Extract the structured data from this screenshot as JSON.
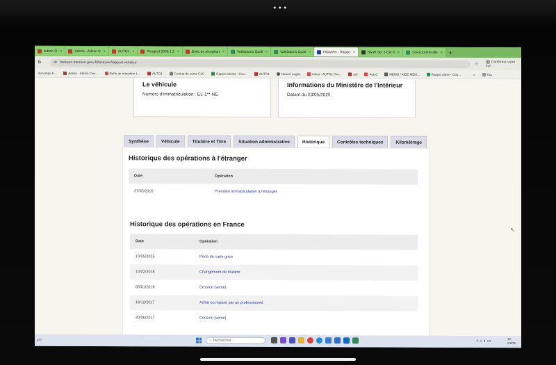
{
  "browser": {
    "tabs": [
      {
        "label": "Admin O"
      },
      {
        "label": "Admin - Admin C"
      },
      {
        "label": "AUTO1"
      },
      {
        "label": "Peugeot 2008 1.2"
      },
      {
        "label": "Boite de réception"
      },
      {
        "label": "Validations Quali"
      },
      {
        "label": "Validations Quali"
      },
      {
        "label": "HistoVec - Rappo"
      },
      {
        "label": "BMW Ser 3 Gie fr"
      },
      {
        "label": "Suivi portefeuille"
      }
    ],
    "active_tab_index": 7,
    "url": "histovec.interieur.gouv.fr/histovec/rapport-vendeur",
    "confirm_label": "Confirmer votre syn",
    "bookmarks": [
      {
        "label": "du temps A..."
      },
      {
        "label": "Admin - Admin Cen..."
      },
      {
        "label": "Boîte de réception L..."
      },
      {
        "label": "AUTO1"
      },
      {
        "label": "Contrat de vente C2C"
      },
      {
        "label": "Rappel clients - Gou..."
      },
      {
        "label": "AUTO1"
      },
      {
        "label": "Nouvel onglet"
      },
      {
        "label": "Inbox - AUTO1 Gro..."
      },
      {
        "label": "pal"
      },
      {
        "label": "Auto1"
      },
      {
        "label": "MÉMO / AIDE MÉM..."
      },
      {
        "label": "Rappel client - Goo..."
      },
      {
        "label": "Tou"
      }
    ]
  },
  "vehicle_card": {
    "title": "Le véhicule",
    "registration": "Numéro d'immatriculation : EL-1**-NE"
  },
  "ministry_card": {
    "title": "Informations du Ministère de l'Intérieur",
    "date": "Datant du 23/05/2025"
  },
  "page_tabs": [
    {
      "label": "Synthèse"
    },
    {
      "label": "Véhicule"
    },
    {
      "label": "Titulaire et Titre"
    },
    {
      "label": "Situation administrative"
    },
    {
      "label": "Historique"
    },
    {
      "label": "Contrôles techniques"
    },
    {
      "label": "Kilométrage"
    }
  ],
  "active_page_tab": "Historique",
  "foreign_history": {
    "title": "Historique des opérations à l'étranger",
    "columns": [
      "Date",
      "Opération"
    ],
    "rows": [
      {
        "date": "27/05/2016",
        "operation": "Première immatriculation à l'étranger"
      }
    ]
  },
  "france_history": {
    "title": "Historique des opérations en France",
    "columns": [
      "Date",
      "Opération"
    ],
    "rows": [
      {
        "date": "10/05/2025",
        "operation": "Perte de carte grise"
      },
      {
        "date": "14/02/2018",
        "operation": "Changement de titulaire"
      },
      {
        "date": "05/01/2018",
        "operation": "Cession (vente)"
      },
      {
        "date": "18/12/2017",
        "operation": "Achat ou reprise par un professionnel"
      },
      {
        "date": "20/06/2017",
        "operation": "Cession (vente)"
      }
    ]
  },
  "taskbar": {
    "search_placeholder": "Rechercher",
    "weather": "8°C",
    "clock_time": "12:",
    "clock_date": "24/05/"
  },
  "colors": {
    "tab_strip": "#78b860",
    "link": "#2a3a9a",
    "taskbar": "#dde3ee"
  }
}
